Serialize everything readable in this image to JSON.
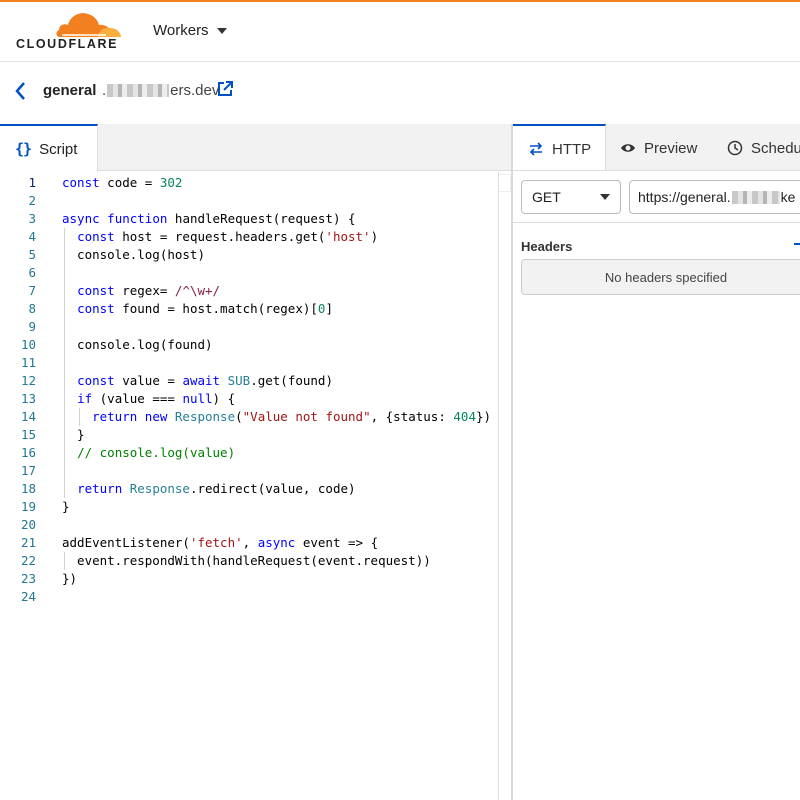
{
  "header": {
    "logo_text": "CLOUDFLARE",
    "product_menu": "Workers"
  },
  "breadcrumb": {
    "worker_name": "general",
    "domain_prefix": ".",
    "domain_suffix": "ers.dev"
  },
  "editor": {
    "tab_icon": "{}",
    "tab_label": "Script",
    "active_line": 1,
    "lines": [
      "const code = 302",
      "",
      "async function handleRequest(request) {",
      "  const host = request.headers.get('host')",
      "  console.log(host)",
      "",
      "  const regex= /^\\w+/",
      "  const found = host.match(regex)[0]",
      "",
      "  console.log(found)",
      "",
      "  const value = await SUB.get(found)",
      "  if (value === null) {",
      "    return new Response(\"Value not found\", {status: 404})",
      "  }",
      "  // console.log(value)",
      "",
      "  return Response.redirect(value, code)",
      "}",
      "",
      "addEventListener('fetch', async event => {",
      "  event.respondWith(handleRequest(event.request))",
      "})",
      ""
    ]
  },
  "tester": {
    "tabs": [
      {
        "label": "HTTP",
        "icon": "arrows-icon"
      },
      {
        "label": "Preview",
        "icon": "eye-icon"
      },
      {
        "label": "Schedu",
        "icon": "clock-icon"
      }
    ],
    "method": "GET",
    "url_prefix": "https://general.",
    "url_suffix": "ke",
    "headers_label": "Headers",
    "no_headers_text": "No headers specified"
  },
  "colors": {
    "brand_orange": "#f38020",
    "accent_blue": "#0051c3"
  }
}
